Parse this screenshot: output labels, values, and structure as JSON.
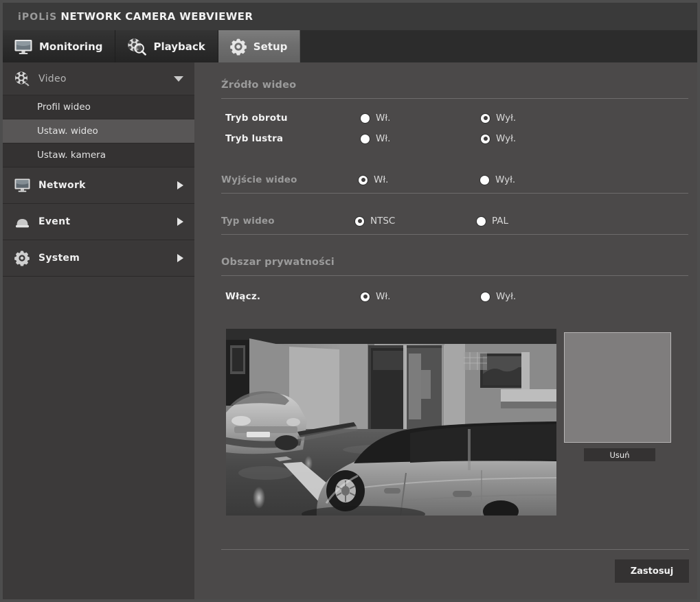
{
  "window": {
    "brand_prefix": "iPOLiS",
    "brand_title": "NETWORK CAMERA WEBVIEWER"
  },
  "tabs": [
    {
      "id": "monitoring",
      "label": "Monitoring",
      "icon": "monitor-icon",
      "active": false
    },
    {
      "id": "playback",
      "label": "Playback",
      "icon": "film-search-icon",
      "active": false
    },
    {
      "id": "setup",
      "label": "Setup",
      "icon": "gear-icon",
      "active": true
    }
  ],
  "sidebar": {
    "groups": [
      {
        "id": "video",
        "label": "Video",
        "icon": "film-reel-icon",
        "expanded": true,
        "arrow": "chevron-down",
        "items": [
          {
            "id": "profil-wideo",
            "label": "Profil wideo",
            "selected": false
          },
          {
            "id": "ustaw-wideo",
            "label": "Ustaw. wideo",
            "selected": true
          },
          {
            "id": "ustaw-kamera",
            "label": "Ustaw. kamera",
            "selected": false
          }
        ]
      },
      {
        "id": "network",
        "label": "Network",
        "icon": "monitor-icon",
        "expanded": false,
        "arrow": "chevron-right",
        "items": []
      },
      {
        "id": "event",
        "label": "Event",
        "icon": "bell-icon",
        "expanded": false,
        "arrow": "chevron-right",
        "items": []
      },
      {
        "id": "system",
        "label": "System",
        "icon": "gear-icon",
        "expanded": false,
        "arrow": "chevron-right",
        "items": []
      }
    ]
  },
  "main": {
    "sections": {
      "video_source": {
        "title": "Źródło wideo",
        "rows": [
          {
            "id": "tryb-obrotu",
            "label": "Tryb obrotu",
            "options": [
              {
                "id": "on",
                "label": "Wł.",
                "selected": false
              },
              {
                "id": "off",
                "label": "Wył.",
                "selected": true
              }
            ]
          },
          {
            "id": "tryb-lustra",
            "label": "Tryb lustra",
            "options": [
              {
                "id": "on",
                "label": "Wł.",
                "selected": false
              },
              {
                "id": "off",
                "label": "Wył.",
                "selected": true
              }
            ]
          }
        ]
      },
      "video_output": {
        "label": "Wyjście wideo",
        "options": [
          {
            "id": "on",
            "label": "Wł.",
            "selected": true
          },
          {
            "id": "off",
            "label": "Wył.",
            "selected": false
          }
        ]
      },
      "video_type": {
        "label": "Typ wideo",
        "options": [
          {
            "id": "ntsc",
            "label": "NTSC",
            "selected": true
          },
          {
            "id": "pal",
            "label": "PAL",
            "selected": false
          }
        ]
      },
      "privacy_area": {
        "title": "Obszar prywatności",
        "enable_label": "Włącz.",
        "options": [
          {
            "id": "on",
            "label": "Wł.",
            "selected": true
          },
          {
            "id": "off",
            "label": "Wył.",
            "selected": false
          }
        ],
        "delete_button": "Usuń"
      }
    },
    "apply_button": "Zastosuj",
    "preview": {
      "alt": "parking-garage-camera-view",
      "description": "Czarno-biały podgląd kamery: parking podziemny z samochodami"
    }
  },
  "colors": {
    "window_bg": "#4a4a4a",
    "titlebar_bg": "#3a3a3a",
    "tabbar_bg": "#2c2c2c",
    "tab_active_bg": "#6e6e6e",
    "sidebar_bg": "#3c3a3a",
    "sidebar_selected_bg": "#585656",
    "content_bg": "#4b4949",
    "divider": "#6e6c6c",
    "label_text": "#f2f2f2",
    "muted_text": "#9b9b9b",
    "button_bg": "#343232",
    "privacy_box": "#7f7d7d"
  }
}
